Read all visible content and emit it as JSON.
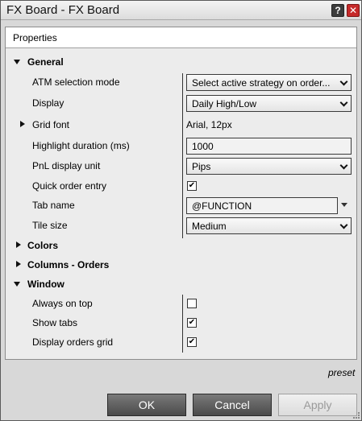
{
  "window": {
    "title": "FX Board - FX Board",
    "help_glyph": "?",
    "close_glyph": "✕"
  },
  "panel": {
    "header": "Properties"
  },
  "categories": {
    "general": {
      "label": "General",
      "expanded": true
    },
    "colors": {
      "label": "Colors",
      "expanded": false
    },
    "columns_orders": {
      "label": "Columns - Orders",
      "expanded": false
    },
    "window": {
      "label": "Window",
      "expanded": true
    }
  },
  "general": {
    "atm_selection_mode": {
      "label": "ATM selection mode",
      "value": "Select active strategy on order..."
    },
    "display": {
      "label": "Display",
      "value": "Daily High/Low"
    },
    "grid_font": {
      "label": "Grid font",
      "value": "Arial, 12px"
    },
    "highlight_duration": {
      "label": "Highlight duration (ms)",
      "value": "1000"
    },
    "pnl_display_unit": {
      "label": "PnL display unit",
      "value": "Pips"
    },
    "quick_order_entry": {
      "label": "Quick order entry",
      "checked": true
    },
    "tab_name": {
      "label": "Tab name",
      "value": "@FUNCTION"
    },
    "tile_size": {
      "label": "Tile size",
      "value": "Medium"
    }
  },
  "window_props": {
    "always_on_top": {
      "label": "Always on top",
      "checked": false
    },
    "show_tabs": {
      "label": "Show tabs",
      "checked": true
    },
    "display_orders_grid": {
      "label": "Display orders grid",
      "checked": true
    }
  },
  "footer": {
    "preset": "preset",
    "ok": "OK",
    "cancel": "Cancel",
    "apply": "Apply"
  },
  "check_glyph": "✔"
}
